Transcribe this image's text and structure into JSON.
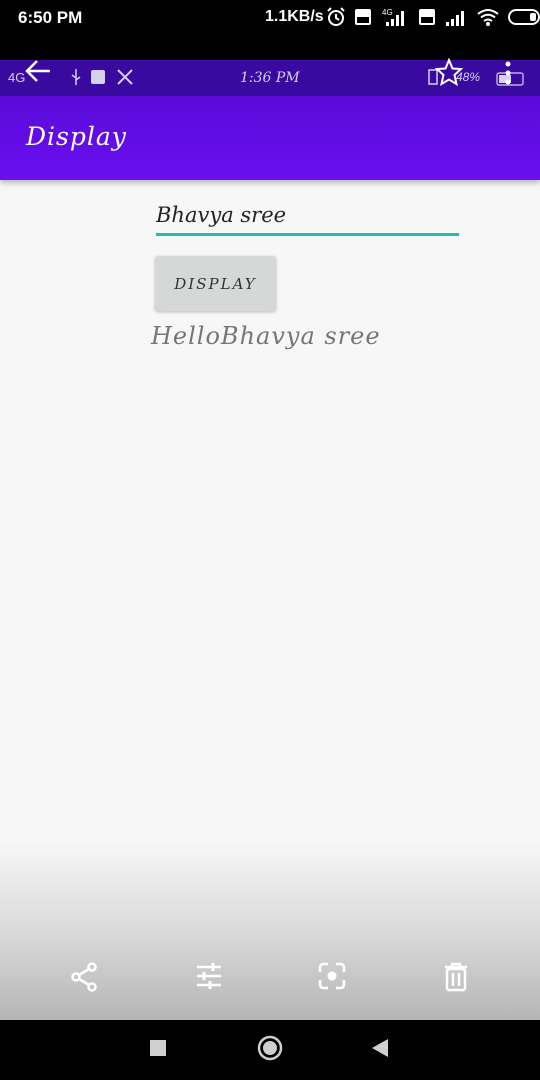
{
  "status_bar": {
    "time": "6:50 PM",
    "net_speed": "1.1KB/s",
    "icons": [
      "alarm-icon",
      "volte-icon",
      "signal-4g-icon",
      "volte-icon",
      "signal-icon",
      "wifi-icon",
      "battery-icon"
    ],
    "signal_label": "4G"
  },
  "inner_status_bar": {
    "network": "4G",
    "time": "1:36 PM",
    "battery": "48%"
  },
  "app_bar": {
    "title": "Display",
    "color": "#5e0be0"
  },
  "form": {
    "name_value": "Bhavya sree",
    "button_label": "DISPLAY",
    "output": "HelloBhavya sree",
    "accent": "#1fbfae"
  },
  "toolbar": {
    "icons": [
      "share-icon",
      "adjust-icon",
      "lens-icon",
      "delete-icon"
    ]
  },
  "nav": {
    "icons": [
      "recents-icon",
      "home-icon",
      "back-icon"
    ]
  }
}
